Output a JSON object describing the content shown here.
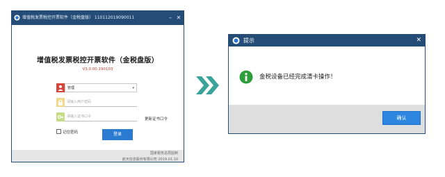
{
  "login_window": {
    "title": "增值税发票税控开票软件（金税盘版）  110112019090011",
    "heading": "增值税发票税控开票软件（金税盘版）",
    "version": "V3.0.00.190103",
    "user_select_value": "管理",
    "password_placeholder": "请输入用户密码",
    "cert_password_placeholder": "请输入证书口令",
    "refresh_link": "更新证书口令",
    "remember_label": "记住密码",
    "login_button": "登录",
    "footer_line1": "国家税务总局监制",
    "footer_line2": "航天信息股份有限公司 2019.01.10",
    "minimize_glyph": "–",
    "close_glyph": "✕",
    "icons": [
      "app-icon",
      "user-icon",
      "lock-icon",
      "key-icon",
      "dropdown-caret-icon"
    ]
  },
  "arrow": {
    "icon": "double-chevron-right-icon",
    "color": "#3aa39a"
  },
  "dialog": {
    "title": "提示",
    "message": "金税设备已经完成清卡操作！",
    "confirm_button": "确认",
    "close_glyph": "✕",
    "icons": [
      "app-icon",
      "info-icon",
      "close-icon"
    ]
  },
  "colors": {
    "titlebar": "#244c77",
    "button_blue": "#2b7ad1",
    "footer_gray": "#e6e6e6",
    "info_green": "#2e9e3a",
    "user_red": "#d9443a",
    "lock_yellow": "#e2b33a",
    "key_green": "#9cc23a"
  }
}
